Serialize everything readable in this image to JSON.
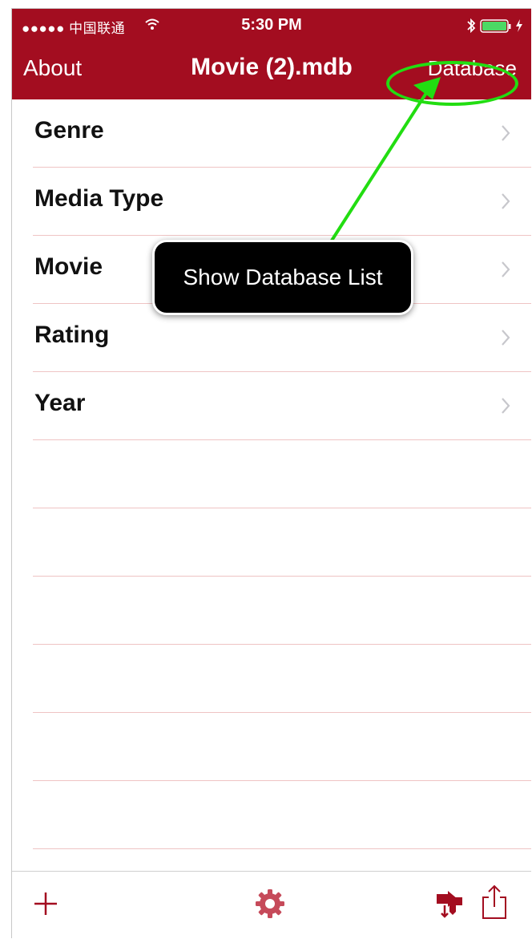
{
  "status_bar": {
    "carrier": "●●●●● 中国联通",
    "time": "5:30 PM",
    "wifi_icon": "wifi-icon",
    "bluetooth_icon": "bluetooth-icon",
    "battery_icon": "battery-icon",
    "battery_level": 0.9
  },
  "nav": {
    "left_label": "About",
    "title": "Movie (2).mdb",
    "right_label": "Database"
  },
  "tables": [
    {
      "label": "Genre"
    },
    {
      "label": "Media Type"
    },
    {
      "label": "Movie"
    },
    {
      "label": "Rating"
    },
    {
      "label": "Year"
    }
  ],
  "annotation": {
    "callout_text": "Show Database List",
    "highlight_color": "#22dd11"
  },
  "toolbar": {
    "add_icon": "plus-icon",
    "settings_icon": "gear-icon",
    "import_icon": "import-icon",
    "share_icon": "share-icon"
  },
  "colors": {
    "accent": "#a30d20",
    "separator": "#efc4c4",
    "chevron": "#c7c7cc"
  }
}
